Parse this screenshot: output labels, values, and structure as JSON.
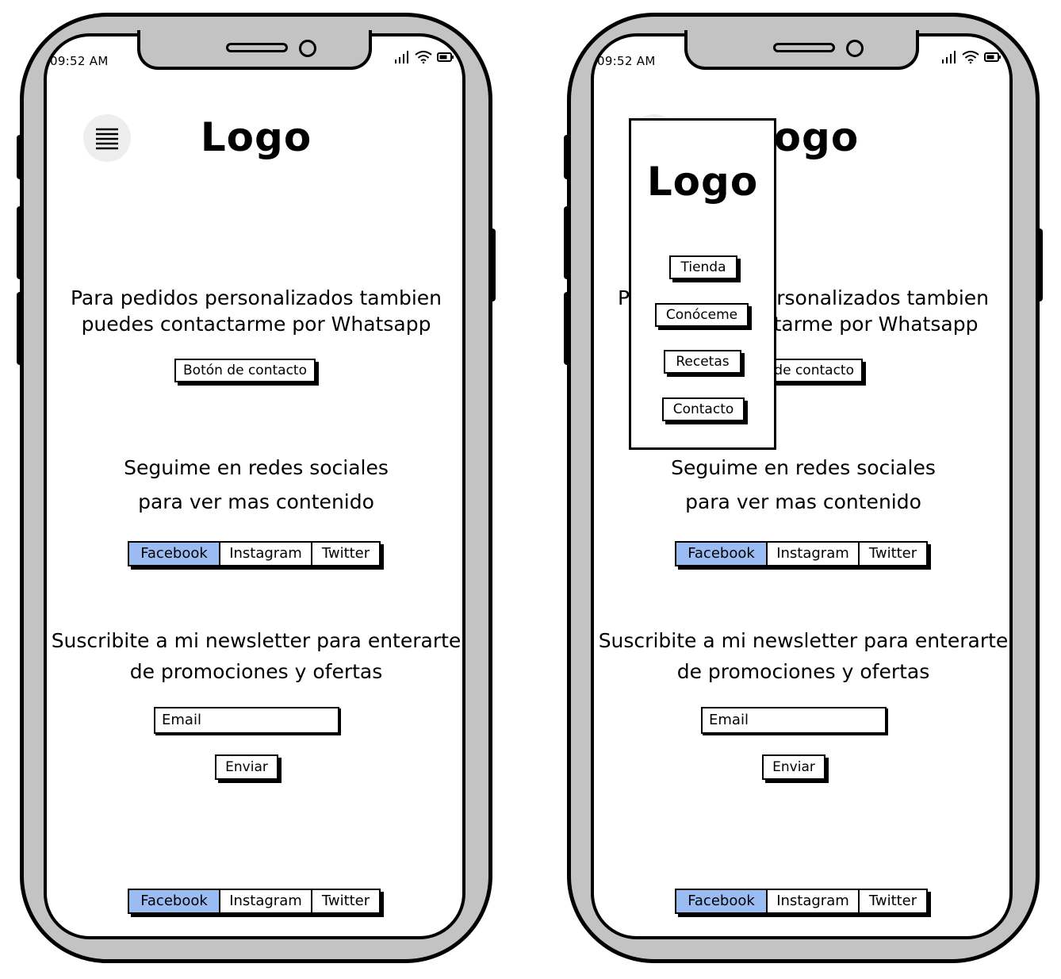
{
  "status_bar": {
    "time": "09:52 AM"
  },
  "header": {
    "logo": "Logo"
  },
  "contact": {
    "text_line1": "Para pedidos personalizados tambien",
    "text_line2": "puedes contactarme por Whatsapp",
    "button_label": "Botón de contacto"
  },
  "social_section": {
    "text_line1": "Seguime en redes sociales",
    "text_line2": "para ver mas contenido",
    "tabs": [
      {
        "label": "Facebook",
        "active": true
      },
      {
        "label": "Instagram",
        "active": false
      },
      {
        "label": "Twitter",
        "active": false
      }
    ]
  },
  "newsletter": {
    "text_line1": "Suscribite a mi newsletter para enterarte",
    "text_line2": "de promociones y ofertas",
    "email_placeholder": "Email",
    "submit_label": "Enviar"
  },
  "footer": {
    "tabs": [
      {
        "label": "Facebook",
        "active": true
      },
      {
        "label": "Instagram",
        "active": false
      },
      {
        "label": "Twitter",
        "active": false
      }
    ]
  },
  "drawer": {
    "logo": "Logo",
    "items": [
      {
        "label": "Tienda"
      },
      {
        "label": "Conóceme"
      },
      {
        "label": "Recetas"
      },
      {
        "label": "Contacto"
      }
    ]
  },
  "colors": {
    "frame": "#c3c3c3",
    "active_tab": "#9bbcf2",
    "menu_button": "#eeeeee"
  }
}
